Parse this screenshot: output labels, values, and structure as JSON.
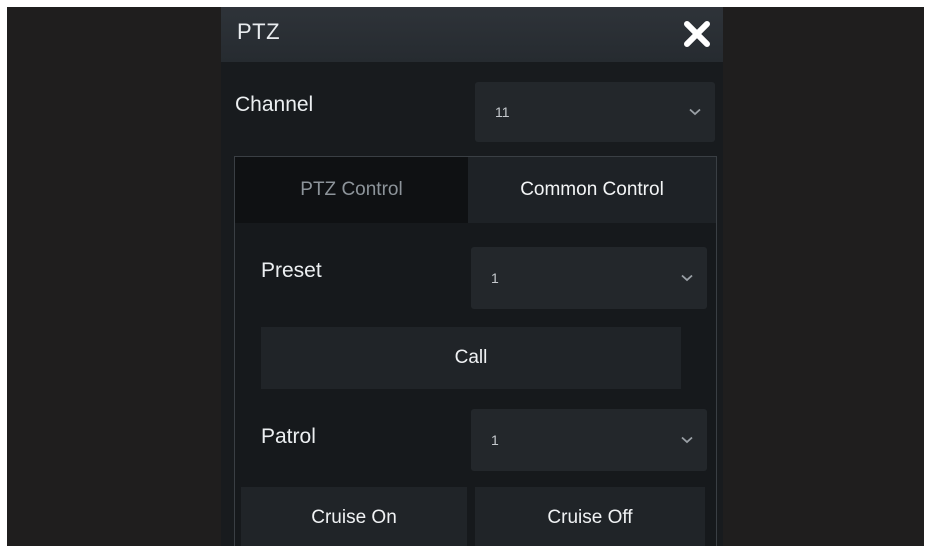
{
  "dialog": {
    "title": "PTZ",
    "close_icon": "close-icon"
  },
  "channel": {
    "label": "Channel",
    "value": "11"
  },
  "tabs": [
    {
      "label": "PTZ Control",
      "active": false
    },
    {
      "label": "Common Control",
      "active": true
    }
  ],
  "preset": {
    "label": "Preset",
    "value": "1"
  },
  "call_button": "Call",
  "patrol": {
    "label": "Patrol",
    "value": "1"
  },
  "cruise": {
    "on_label": "Cruise On",
    "off_label": "Cruise Off"
  },
  "colors": {
    "background": "#1f1e1e",
    "panel": "#181b1e",
    "title_bar": "#2b3035",
    "text": "#eceff1",
    "inactive_tab_text": "#8d949a"
  }
}
